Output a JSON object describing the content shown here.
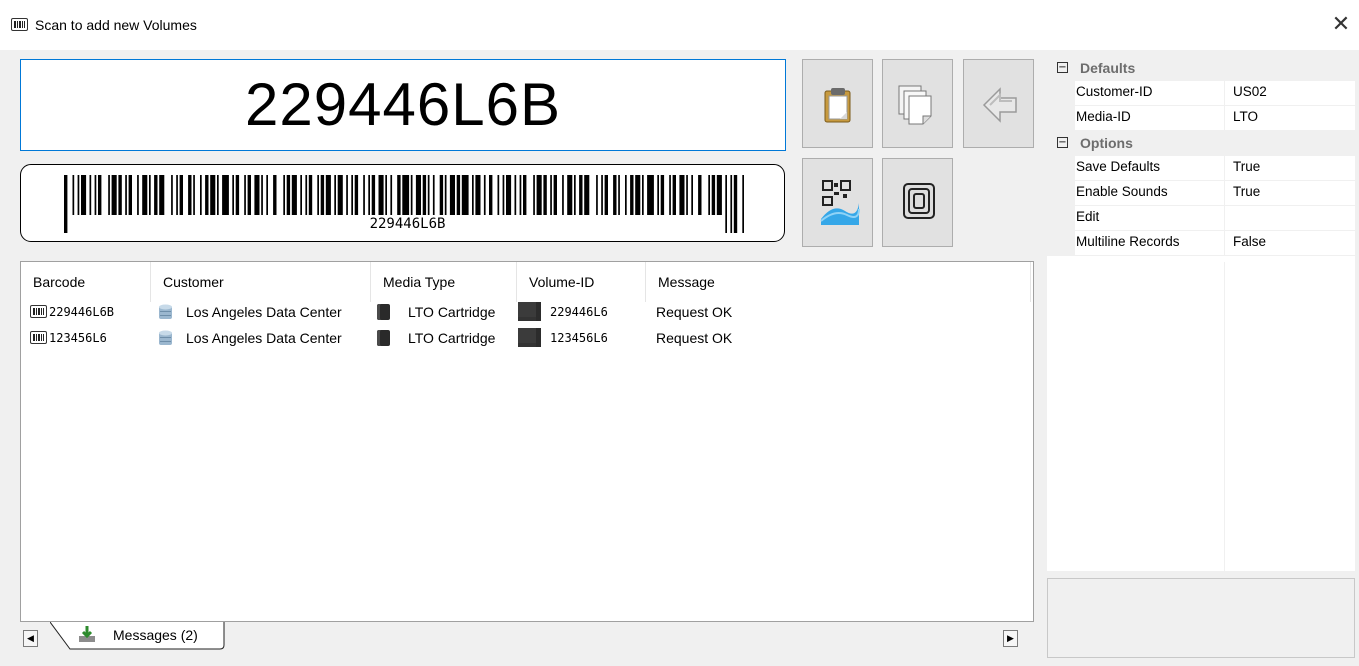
{
  "window": {
    "title": "Scan to add new Volumes",
    "close_label": "✕"
  },
  "scan": {
    "barcode_value": "229446L6B",
    "barcode_caption": "229446L6B"
  },
  "toolbar": {
    "buttons": [
      "paste-clipboard",
      "copy",
      "back",
      "qr-code",
      "rfid"
    ]
  },
  "list": {
    "columns": [
      "Barcode",
      "Customer",
      "Media Type",
      "Volume-ID",
      "Message"
    ],
    "rows": [
      {
        "barcode": "229446L6B",
        "customer": "Los Angeles Data Center",
        "media_type": "LTO Cartridge",
        "volume_id": "229446L6",
        "message": "Request OK"
      },
      {
        "barcode": "123456L6",
        "customer": "Los Angeles Data Center",
        "media_type": "LTO Cartridge",
        "volume_id": "123456L6",
        "message": "Request OK"
      }
    ]
  },
  "tabs": {
    "messages_label": "Messages (2)",
    "left_arrow": "◀",
    "right_arrow": "▶"
  },
  "properties": {
    "defaults": {
      "label": "Defaults",
      "toggle": "−",
      "rows": [
        {
          "name": "Customer-ID",
          "value": "US02"
        },
        {
          "name": "Media-ID",
          "value": "LTO"
        }
      ]
    },
    "options": {
      "label": "Options",
      "toggle": "−",
      "rows": [
        {
          "name": "Save Defaults",
          "value": "True"
        },
        {
          "name": "Enable Sounds",
          "value": "True"
        },
        {
          "name": "Edit",
          "value": ""
        },
        {
          "name": "Multiline Records",
          "value": "False"
        }
      ]
    }
  },
  "colors": {
    "focus_border": "#0078d7",
    "button_face": "#e1e1e1",
    "category_text": "#6d6d6d"
  }
}
